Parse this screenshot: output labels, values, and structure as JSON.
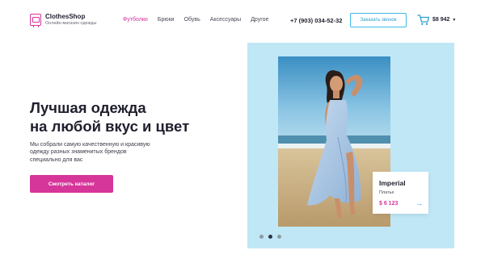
{
  "header": {
    "logo": {
      "name": "ClothesShop",
      "tagline": "Онлайн-магазин одежды",
      "icon": "wardrobe-icon"
    },
    "nav": [
      {
        "label": "Футболки",
        "active": true
      },
      {
        "label": "Брюки",
        "active": false
      },
      {
        "label": "Обувь",
        "active": false
      },
      {
        "label": "Аксессуары",
        "active": false
      },
      {
        "label": "Другое",
        "active": false
      }
    ],
    "phone": "+7 (903) 034-52-32",
    "call_button": "Заказать звонок",
    "cart": {
      "icon": "cart-icon",
      "total": "$8 942"
    }
  },
  "hero": {
    "title": "Лучшая одежда\nна любой вкус и цвет",
    "description": "Мы собрали самую качественную и красивую\nодежду разных знаменитых брендов\nспециально для вас",
    "cta": "Смотреть каталог"
  },
  "product_card": {
    "name": "Imperial",
    "type": "Платье",
    "price": "$ 6 123",
    "arrow_icon": "arrow-right-icon"
  },
  "slider": {
    "count": 3,
    "active_index": 1
  },
  "colors": {
    "accent": "#d6359a",
    "secondary": "#3cb9e6",
    "panel": "#bfe7f6"
  }
}
